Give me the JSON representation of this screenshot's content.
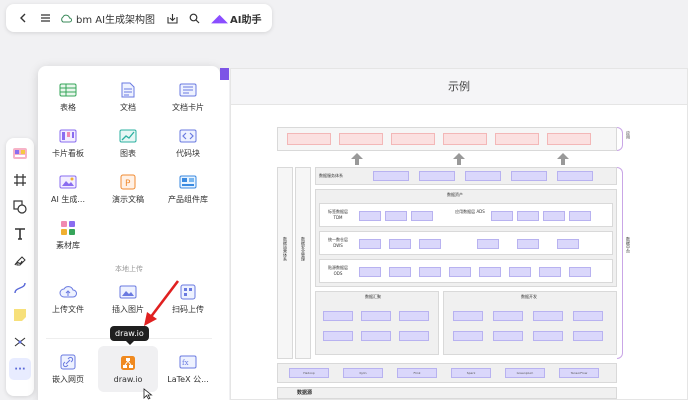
{
  "topbar": {
    "doc_title": "bm AI生成架构图",
    "ai_label": "AI助手"
  },
  "panel": {
    "items_top": [
      {
        "label": "表格",
        "icon": "table-icon"
      },
      {
        "label": "文档",
        "icon": "doc-icon"
      },
      {
        "label": "文档卡片",
        "icon": "doc-card-icon"
      },
      {
        "label": "卡片看板",
        "icon": "kanban-icon"
      },
      {
        "label": "图表",
        "icon": "chart-icon"
      },
      {
        "label": "代码块",
        "icon": "code-icon"
      },
      {
        "label": "AI 生成...",
        "icon": "ai-image-icon"
      },
      {
        "label": "演示文稿",
        "icon": "slides-icon"
      },
      {
        "label": "产品组件库",
        "icon": "component-lib-icon"
      },
      {
        "label": "素材库",
        "icon": "material-icon"
      }
    ],
    "upload_section": "本地上传",
    "items_upload": [
      {
        "label": "上传文件",
        "icon": "upload-cloud-icon"
      },
      {
        "label": "插入图片",
        "icon": "image-icon"
      },
      {
        "label": "扫码上传",
        "icon": "qr-icon"
      }
    ],
    "items_bottom": [
      {
        "label": "嵌入网页",
        "icon": "link-icon"
      },
      {
        "label": "draw.io",
        "icon": "drawio-icon"
      },
      {
        "label": "LaTeX 公...",
        "icon": "latex-icon"
      }
    ],
    "tooltip": "draw.io"
  },
  "canvas": {
    "title": "示例",
    "diagram": {
      "top_right_label": "应用",
      "mid_right_label": "数据中台",
      "left_labels": [
        "数据运营体系",
        "数据安全管理"
      ],
      "service_layer": "数据服务体系",
      "asset_layer": "数据资产",
      "aggregation": "数据汇聚",
      "development": "数据开发",
      "rows": [
        {
          "name": "标签数据层 TDM",
          "right": "应用数据层 ADS"
        },
        {
          "name": "统一数仓层 DWS",
          "right": ""
        },
        {
          "name": "贴源数据层 ODS",
          "right": ""
        }
      ],
      "tools": [
        "Hadoop",
        "Kylin",
        "Flink",
        "Spark",
        "Greenplum",
        "TensorFlow"
      ],
      "bottom": "数据源"
    }
  },
  "colors": {
    "accent": "#7c54e6",
    "pink_box": "#fbe0e0",
    "blue_box": "#dad7fb",
    "arrow": "#e02020"
  }
}
